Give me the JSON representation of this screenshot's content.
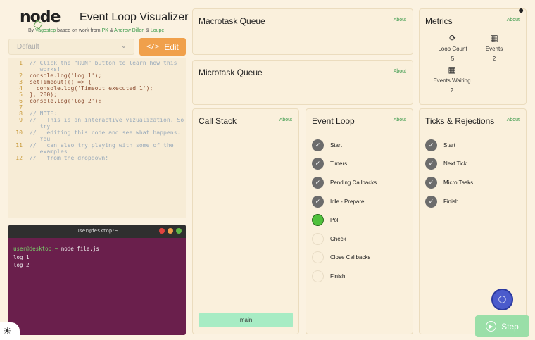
{
  "logo": {
    "word": "node",
    "sub": "js"
  },
  "app": {
    "title": "Event Loop Visualizer",
    "credits": {
      "by": "By ",
      "author": "Vagostep",
      "mid": " based on work from ",
      "pk": "PK",
      "amp1": " & ",
      "andrew": "Andrew Dillon",
      "amp2": " & ",
      "loupe": "Loupe",
      "end": "."
    }
  },
  "toolbar": {
    "dropdown_value": "Default",
    "edit_label": "Edit"
  },
  "code": [
    {
      "n": "1",
      "t": "// Click the \"RUN\" button to learn how this\n   works!",
      "k": "comment"
    },
    {
      "n": "2",
      "t": "console.log('log 1');",
      "k": "code"
    },
    {
      "n": "3",
      "t": "setTimeout(() => {",
      "k": "code"
    },
    {
      "n": "4",
      "t": "  console.log('Timeout executed 1');",
      "k": "code"
    },
    {
      "n": "5",
      "t": "}, 200);",
      "k": "code"
    },
    {
      "n": "6",
      "t": "console.log('log 2');",
      "k": "code"
    },
    {
      "n": "7",
      "t": "",
      "k": "code"
    },
    {
      "n": "8",
      "t": "// NOTE:",
      "k": "comment"
    },
    {
      "n": "9",
      "t": "//   This is an interactive vizualization. So\n   try",
      "k": "comment"
    },
    {
      "n": "10",
      "t": "//   editing this code and see what happens.\n   You",
      "k": "comment"
    },
    {
      "n": "11",
      "t": "//   can also try playing with some of the\n   examples",
      "k": "comment"
    },
    {
      "n": "12",
      "t": "//   from the dropdown!",
      "k": "comment"
    }
  ],
  "terminal": {
    "title": "user@desktop:~",
    "prompt": "user@desktop:~",
    "command": " node file.js",
    "output": [
      "log 1",
      "log 2"
    ],
    "dot_colors": [
      "#e0433f",
      "#f0a04b",
      "#5fb946"
    ]
  },
  "panels": {
    "macrotask": {
      "title": "Macrotask Queue",
      "about": "About"
    },
    "microtask": {
      "title": "Microtask Queue",
      "about": "About"
    },
    "callstack": {
      "title": "Call Stack",
      "about": "About",
      "frame": "main"
    },
    "eventloop": {
      "title": "Event Loop",
      "about": "About",
      "steps": [
        {
          "label": "Start",
          "state": "done"
        },
        {
          "label": "Timers",
          "state": "done"
        },
        {
          "label": "Pending Callbacks",
          "state": "done"
        },
        {
          "label": "Idle - Prepare",
          "state": "done"
        },
        {
          "label": "Poll",
          "state": "active"
        },
        {
          "label": "Check",
          "state": "pending"
        },
        {
          "label": "Close Callbacks",
          "state": "pending"
        },
        {
          "label": "Finish",
          "state": "pending"
        }
      ]
    },
    "metrics": {
      "title": "Metrics",
      "about": "About",
      "loop_count": {
        "label": "Loop Count",
        "value": "5",
        "icon": "refresh-icon"
      },
      "events": {
        "label": "Events",
        "value": "2",
        "icon": "calendar-icon"
      },
      "events_waiting": {
        "label": "Events Waiting",
        "value": "2",
        "icon": "calendar-clock-icon"
      }
    },
    "ticks": {
      "title": "Ticks & Rejections",
      "about": "About",
      "steps": [
        {
          "label": "Start",
          "state": "done"
        },
        {
          "label": "Next Tick",
          "state": "done"
        },
        {
          "label": "Micro Tasks",
          "state": "done"
        },
        {
          "label": "Finish",
          "state": "done"
        }
      ]
    }
  },
  "controls": {
    "step_label": "Step"
  },
  "colors": {
    "accent": "#f0a04b",
    "link": "#3b9a4b",
    "active": "#4fc13c",
    "terminal_bg": "#6a1f4c"
  }
}
